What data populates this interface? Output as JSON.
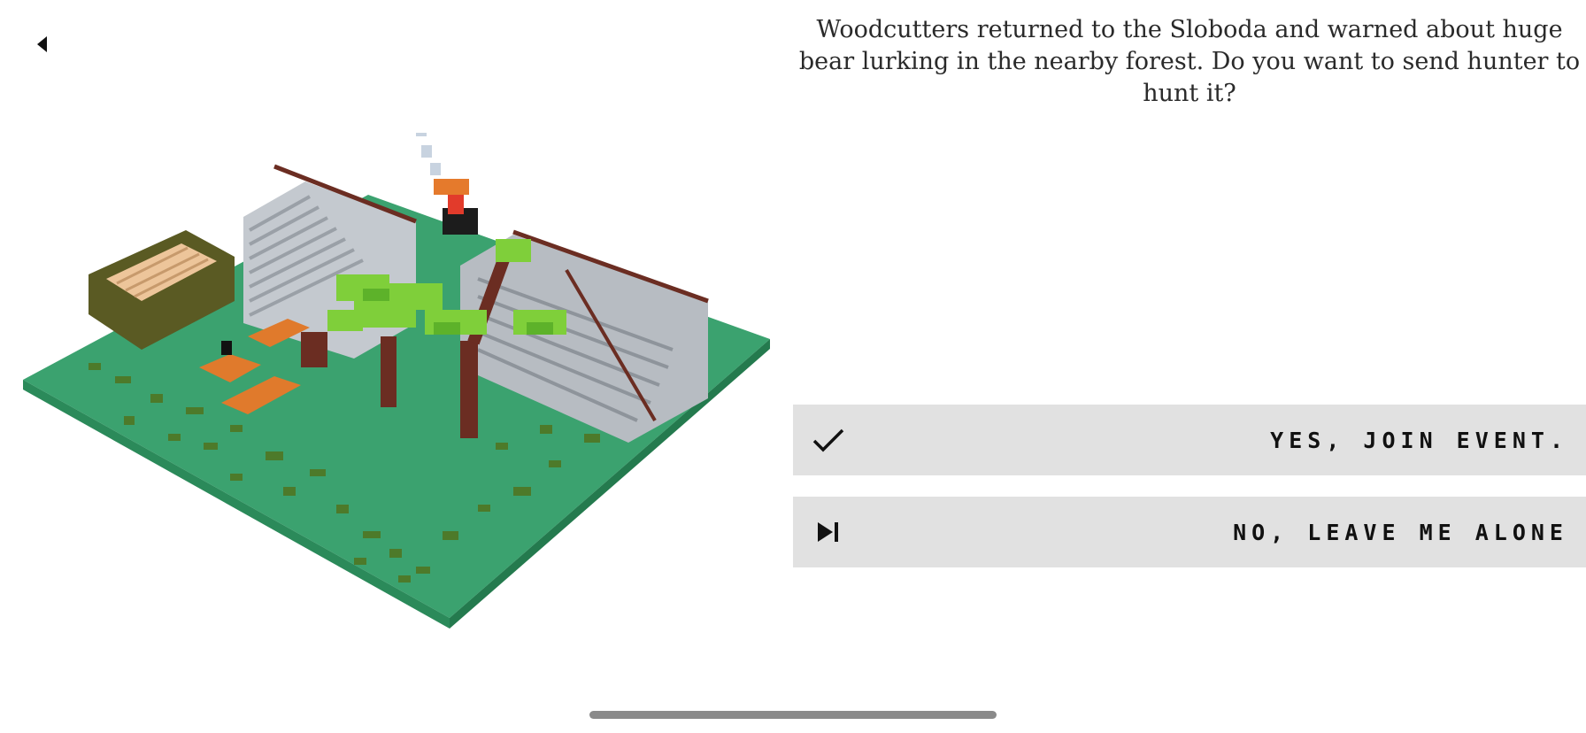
{
  "icons": {
    "back": "caret-left-icon",
    "yes": "checkmark-icon",
    "no": "skip-next-icon"
  },
  "event": {
    "text": "Woodcutters returned to the Sloboda and warned about huge bear lurking in the nearby forest. Do you want to send hunter to hunt it?"
  },
  "choices": {
    "yes_label": "YES, JOIN EVENT.",
    "no_label": "NO, LEAVE ME ALONE"
  },
  "colors": {
    "ground": "#3aa06f",
    "button_bg": "#e1e1e1",
    "tree_leaves": "#7fcf3a",
    "trunk": "#6b2d22",
    "roof": "#b7bcc2"
  }
}
